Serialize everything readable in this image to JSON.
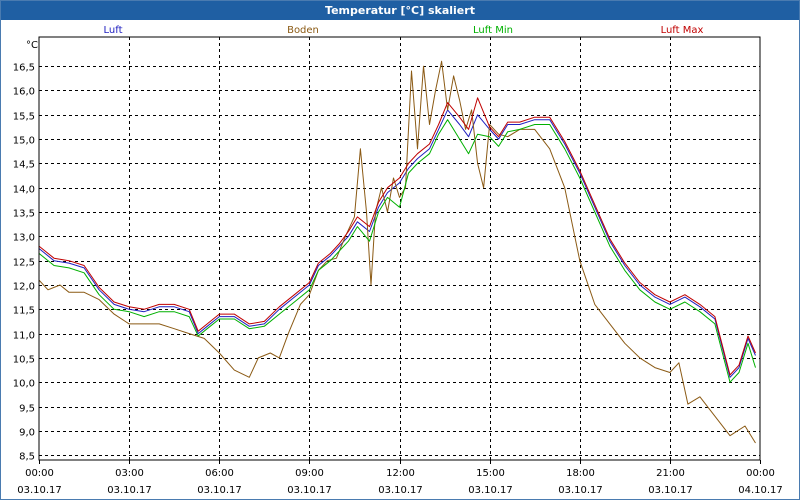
{
  "window": {
    "title": "Temperatur [°C] skaliert"
  },
  "colors": {
    "titlebar": "#1f5fa3",
    "grid": "#000000",
    "background": "#ffffff"
  },
  "chart_data": {
    "type": "line",
    "title": "Temperatur [°C] skaliert",
    "ylabel": "°C",
    "xlabel": "",
    "ylim": [
      8.4,
      17.1
    ],
    "xlim": [
      0,
      24
    ],
    "grid": true,
    "legend_position": "top",
    "yticks": [
      "16,5",
      "16,0",
      "15,5",
      "15,0",
      "14,5",
      "14,0",
      "13,5",
      "13,0",
      "12,5",
      "12,0",
      "11,5",
      "11,0",
      "10,5",
      "10,0",
      "9,5",
      "9,0",
      "8,5"
    ],
    "xticks": [
      {
        "time": "00:00",
        "date": "03.10.17"
      },
      {
        "time": "03:00",
        "date": "03.10.17"
      },
      {
        "time": "06:00",
        "date": "03.10.17"
      },
      {
        "time": "09:00",
        "date": "03.10.17"
      },
      {
        "time": "12:00",
        "date": "03.10.17"
      },
      {
        "time": "15:00",
        "date": "03.10.17"
      },
      {
        "time": "18:00",
        "date": "03.10.17"
      },
      {
        "time": "21:00",
        "date": "03.10.17"
      },
      {
        "time": "00:00",
        "date": "04.10.17"
      }
    ],
    "series": [
      {
        "name": "Luft",
        "color": "#2020c0",
        "points": [
          [
            0,
            12.75
          ],
          [
            0.5,
            12.5
          ],
          [
            1,
            12.45
          ],
          [
            1.5,
            12.35
          ],
          [
            2,
            11.9
          ],
          [
            2.5,
            11.6
          ],
          [
            3,
            11.5
          ],
          [
            3.5,
            11.45
          ],
          [
            4,
            11.55
          ],
          [
            4.5,
            11.55
          ],
          [
            5,
            11.45
          ],
          [
            5.3,
            11.0
          ],
          [
            5.6,
            11.15
          ],
          [
            6,
            11.35
          ],
          [
            6.5,
            11.35
          ],
          [
            7,
            11.15
          ],
          [
            7.5,
            11.2
          ],
          [
            8,
            11.5
          ],
          [
            8.5,
            11.75
          ],
          [
            9,
            12.0
          ],
          [
            9.3,
            12.4
          ],
          [
            9.7,
            12.6
          ],
          [
            10,
            12.8
          ],
          [
            10.3,
            13.0
          ],
          [
            10.6,
            13.3
          ],
          [
            11,
            13.1
          ],
          [
            11.3,
            13.6
          ],
          [
            11.6,
            13.9
          ],
          [
            12,
            14.1
          ],
          [
            12.3,
            14.4
          ],
          [
            12.6,
            14.6
          ],
          [
            13,
            14.8
          ],
          [
            13.3,
            15.2
          ],
          [
            13.6,
            15.6
          ],
          [
            14,
            15.3
          ],
          [
            14.3,
            15.05
          ],
          [
            14.6,
            15.5
          ],
          [
            15,
            15.2
          ],
          [
            15.3,
            15.0
          ],
          [
            15.6,
            15.3
          ],
          [
            16,
            15.3
          ],
          [
            16.5,
            15.4
          ],
          [
            17,
            15.4
          ],
          [
            17.5,
            14.9
          ],
          [
            18,
            14.3
          ],
          [
            18.5,
            13.6
          ],
          [
            19,
            12.9
          ],
          [
            19.5,
            12.4
          ],
          [
            20,
            12.0
          ],
          [
            20.5,
            11.75
          ],
          [
            21,
            11.6
          ],
          [
            21.5,
            11.75
          ],
          [
            22,
            11.55
          ],
          [
            22.5,
            11.3
          ],
          [
            23,
            10.1
          ],
          [
            23.3,
            10.3
          ],
          [
            23.6,
            10.9
          ],
          [
            23.85,
            10.55
          ]
        ]
      },
      {
        "name": "Boden",
        "color": "#8b5a14",
        "points": [
          [
            0,
            12.1
          ],
          [
            0.3,
            11.9
          ],
          [
            0.7,
            12.0
          ],
          [
            1,
            11.85
          ],
          [
            1.5,
            11.85
          ],
          [
            2,
            11.7
          ],
          [
            2.5,
            11.4
          ],
          [
            3,
            11.2
          ],
          [
            3.5,
            11.2
          ],
          [
            4,
            11.2
          ],
          [
            4.5,
            11.1
          ],
          [
            5,
            11.0
          ],
          [
            5.5,
            10.9
          ],
          [
            6,
            10.6
          ],
          [
            6.5,
            10.25
          ],
          [
            7,
            10.1
          ],
          [
            7.3,
            10.5
          ],
          [
            7.7,
            10.6
          ],
          [
            8,
            10.5
          ],
          [
            8.3,
            11.0
          ],
          [
            8.7,
            11.6
          ],
          [
            9,
            11.8
          ],
          [
            9.3,
            12.3
          ],
          [
            9.6,
            12.5
          ],
          [
            9.9,
            12.55
          ],
          [
            10.2,
            13.0
          ],
          [
            10.5,
            13.4
          ],
          [
            10.7,
            14.8
          ],
          [
            10.9,
            13.5
          ],
          [
            11.05,
            12.0
          ],
          [
            11.2,
            13.5
          ],
          [
            11.4,
            14.0
          ],
          [
            11.6,
            13.5
          ],
          [
            11.8,
            14.2
          ],
          [
            12.0,
            13.8
          ],
          [
            12.2,
            14.0
          ],
          [
            12.4,
            16.4
          ],
          [
            12.6,
            14.8
          ],
          [
            12.8,
            16.5
          ],
          [
            13.0,
            15.3
          ],
          [
            13.2,
            16.0
          ],
          [
            13.4,
            16.6
          ],
          [
            13.6,
            15.6
          ],
          [
            13.8,
            16.3
          ],
          [
            14.0,
            15.8
          ],
          [
            14.2,
            15.2
          ],
          [
            14.4,
            15.6
          ],
          [
            14.6,
            14.5
          ],
          [
            14.8,
            14.0
          ],
          [
            15.0,
            15.3
          ],
          [
            15.3,
            15.1
          ],
          [
            15.6,
            15.05
          ],
          [
            16,
            15.2
          ],
          [
            16.5,
            15.2
          ],
          [
            17,
            14.8
          ],
          [
            17.5,
            14.0
          ],
          [
            18,
            12.5
          ],
          [
            18.5,
            11.6
          ],
          [
            19,
            11.2
          ],
          [
            19.5,
            10.8
          ],
          [
            20,
            10.5
          ],
          [
            20.5,
            10.3
          ],
          [
            21,
            10.2
          ],
          [
            21.3,
            10.4
          ],
          [
            21.6,
            9.55
          ],
          [
            22,
            9.7
          ],
          [
            22.5,
            9.3
          ],
          [
            23,
            8.9
          ],
          [
            23.5,
            9.1
          ],
          [
            23.85,
            8.75
          ]
        ]
      },
      {
        "name": "Luft Min",
        "color": "#00b000",
        "points": [
          [
            0,
            12.65
          ],
          [
            0.5,
            12.4
          ],
          [
            1,
            12.35
          ],
          [
            1.5,
            12.25
          ],
          [
            2,
            11.8
          ],
          [
            2.5,
            11.5
          ],
          [
            3,
            11.45
          ],
          [
            3.5,
            11.35
          ],
          [
            4,
            11.45
          ],
          [
            4.5,
            11.45
          ],
          [
            5,
            11.35
          ],
          [
            5.3,
            10.95
          ],
          [
            5.6,
            11.1
          ],
          [
            6,
            11.3
          ],
          [
            6.5,
            11.3
          ],
          [
            7,
            11.1
          ],
          [
            7.5,
            11.15
          ],
          [
            8,
            11.4
          ],
          [
            8.5,
            11.65
          ],
          [
            9,
            11.9
          ],
          [
            9.3,
            12.3
          ],
          [
            9.7,
            12.5
          ],
          [
            10,
            12.7
          ],
          [
            10.3,
            12.9
          ],
          [
            10.6,
            13.2
          ],
          [
            11,
            12.9
          ],
          [
            11.3,
            13.5
          ],
          [
            11.6,
            13.8
          ],
          [
            12,
            13.6
          ],
          [
            12.3,
            14.3
          ],
          [
            12.6,
            14.5
          ],
          [
            13,
            14.7
          ],
          [
            13.3,
            15.1
          ],
          [
            13.6,
            15.4
          ],
          [
            14,
            15.0
          ],
          [
            14.3,
            14.7
          ],
          [
            14.6,
            15.1
          ],
          [
            15,
            15.05
          ],
          [
            15.3,
            14.85
          ],
          [
            15.6,
            15.15
          ],
          [
            16,
            15.2
          ],
          [
            16.5,
            15.3
          ],
          [
            17,
            15.3
          ],
          [
            17.5,
            14.8
          ],
          [
            18,
            14.2
          ],
          [
            18.5,
            13.5
          ],
          [
            19,
            12.8
          ],
          [
            19.5,
            12.3
          ],
          [
            20,
            11.9
          ],
          [
            20.5,
            11.65
          ],
          [
            21,
            11.5
          ],
          [
            21.5,
            11.65
          ],
          [
            22,
            11.45
          ],
          [
            22.5,
            11.2
          ],
          [
            23,
            10.0
          ],
          [
            23.3,
            10.2
          ],
          [
            23.6,
            10.8
          ],
          [
            23.85,
            10.3
          ]
        ]
      },
      {
        "name": "Luft Max",
        "color": "#c00000",
        "points": [
          [
            0,
            12.8
          ],
          [
            0.5,
            12.55
          ],
          [
            1,
            12.5
          ],
          [
            1.5,
            12.4
          ],
          [
            2,
            11.95
          ],
          [
            2.5,
            11.65
          ],
          [
            3,
            11.55
          ],
          [
            3.5,
            11.5
          ],
          [
            4,
            11.6
          ],
          [
            4.5,
            11.6
          ],
          [
            5,
            11.5
          ],
          [
            5.3,
            11.05
          ],
          [
            5.6,
            11.2
          ],
          [
            6,
            11.4
          ],
          [
            6.5,
            11.4
          ],
          [
            7,
            11.2
          ],
          [
            7.5,
            11.25
          ],
          [
            8,
            11.55
          ],
          [
            8.5,
            11.8
          ],
          [
            9,
            12.05
          ],
          [
            9.3,
            12.45
          ],
          [
            9.7,
            12.65
          ],
          [
            10,
            12.85
          ],
          [
            10.3,
            13.1
          ],
          [
            10.6,
            13.4
          ],
          [
            11,
            13.2
          ],
          [
            11.3,
            13.7
          ],
          [
            11.6,
            14.0
          ],
          [
            12,
            14.2
          ],
          [
            12.3,
            14.5
          ],
          [
            12.6,
            14.7
          ],
          [
            13,
            14.9
          ],
          [
            13.3,
            15.3
          ],
          [
            13.6,
            15.75
          ],
          [
            14,
            15.45
          ],
          [
            14.3,
            15.2
          ],
          [
            14.6,
            15.85
          ],
          [
            15,
            15.25
          ],
          [
            15.3,
            15.05
          ],
          [
            15.6,
            15.35
          ],
          [
            16,
            15.35
          ],
          [
            16.5,
            15.45
          ],
          [
            17,
            15.45
          ],
          [
            17.5,
            14.95
          ],
          [
            18,
            14.35
          ],
          [
            18.5,
            13.65
          ],
          [
            19,
            12.95
          ],
          [
            19.5,
            12.45
          ],
          [
            20,
            12.05
          ],
          [
            20.5,
            11.8
          ],
          [
            21,
            11.65
          ],
          [
            21.5,
            11.8
          ],
          [
            22,
            11.6
          ],
          [
            22.5,
            11.35
          ],
          [
            23,
            10.15
          ],
          [
            23.3,
            10.35
          ],
          [
            23.6,
            10.95
          ],
          [
            23.85,
            10.6
          ]
        ]
      }
    ]
  }
}
